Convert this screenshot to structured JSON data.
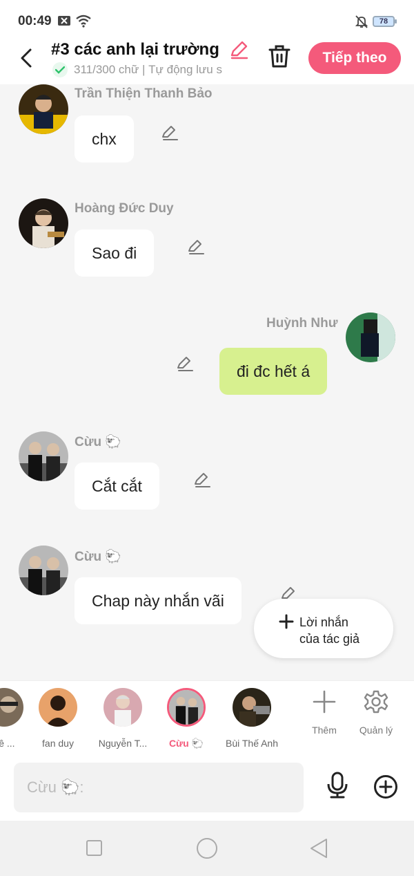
{
  "status_bar": {
    "time": "00:49",
    "battery": "78"
  },
  "header": {
    "title": "#3 các anh lại trường",
    "word_count": "311/300 chữ",
    "autosave": "Tự động lưu s",
    "separator": " | ",
    "next_label": "Tiếp theo"
  },
  "messages": [
    {
      "sender": "Trần Thiện Thanh Bảo",
      "text": "chx",
      "side": "left"
    },
    {
      "sender": "Hoàng Đức Duy",
      "text": "Sao đi",
      "side": "left"
    },
    {
      "sender": "Huỳnh Như",
      "text": "đi đc hết á",
      "side": "right"
    },
    {
      "sender": "Cừu 🐑",
      "text": "Cắt cắt",
      "side": "left"
    },
    {
      "sender": "Cừu 🐑",
      "text": "Chap này nhắn vãi",
      "side": "left"
    }
  ],
  "author_note_button": {
    "line1": "Lời nhắn",
    "line2": "của tác giả"
  },
  "characters": [
    {
      "name": "Lê ..."
    },
    {
      "name": "fan duy"
    },
    {
      "name": "Nguyễn T..."
    },
    {
      "name": "Cừu 🐑",
      "active": true
    },
    {
      "name": "Bùi Thế Anh"
    }
  ],
  "tools": {
    "add_label": "Thêm",
    "manage_label": "Quản lý"
  },
  "input": {
    "placeholder": "Cừu 🐑:"
  },
  "colors": {
    "accent": "#f45a7b",
    "my_bubble": "#d7f08f",
    "background": "#f5f5f5"
  }
}
